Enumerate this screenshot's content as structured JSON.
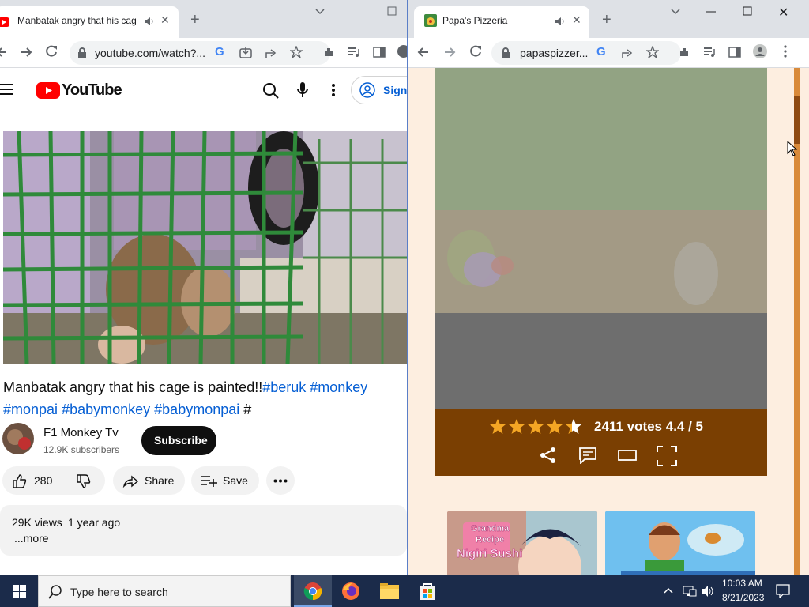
{
  "left_window": {
    "tab_title": "Manbatak angry that his cage",
    "url": "youtube.com/watch?...",
    "youtube": {
      "logo_text": "YouTube",
      "sign_in_label": "Sign",
      "video_title_plain": "Manbatak angry that his cage is painted!!",
      "hashtag_1": "#beruk",
      "hashtag_2": "#monkey",
      "hashtag_3": "#monpai",
      "hashtag_4": "#babymonkey",
      "hashtag_5": "#babymonpai",
      "hashtag_tail": "#",
      "channel_name": "F1 Monkey Tv",
      "subscribers": "12.9K subscribers",
      "subscribe_label": "Subscribe",
      "like_count": "280",
      "share_label": "Share",
      "save_label": "Save",
      "views": "29K views",
      "age": "1 year ago",
      "more_label": "...more"
    }
  },
  "right_window": {
    "tab_title": "Papa's Pizzeria",
    "url": "papaspizzer...",
    "game": {
      "votes_text": "2411 votes 4.4 / 5",
      "rating": 4.4,
      "stars_total": 5,
      "thumb_1_line1": "Grandma",
      "thumb_1_line2": "Recipe",
      "thumb_1_line3": "Nigiri Sushi"
    }
  },
  "taskbar": {
    "search_placeholder": "Type here to search",
    "time": "10:03 AM",
    "date": "8/21/2023"
  },
  "colors": {
    "youtube_red": "#ff0000",
    "link_blue": "#065fd4",
    "game_bar_brown": "#7a3f02",
    "page_cream": "#fdeee0",
    "scroll_orange": "#d98a3a",
    "star_gold": "#f4a624"
  }
}
